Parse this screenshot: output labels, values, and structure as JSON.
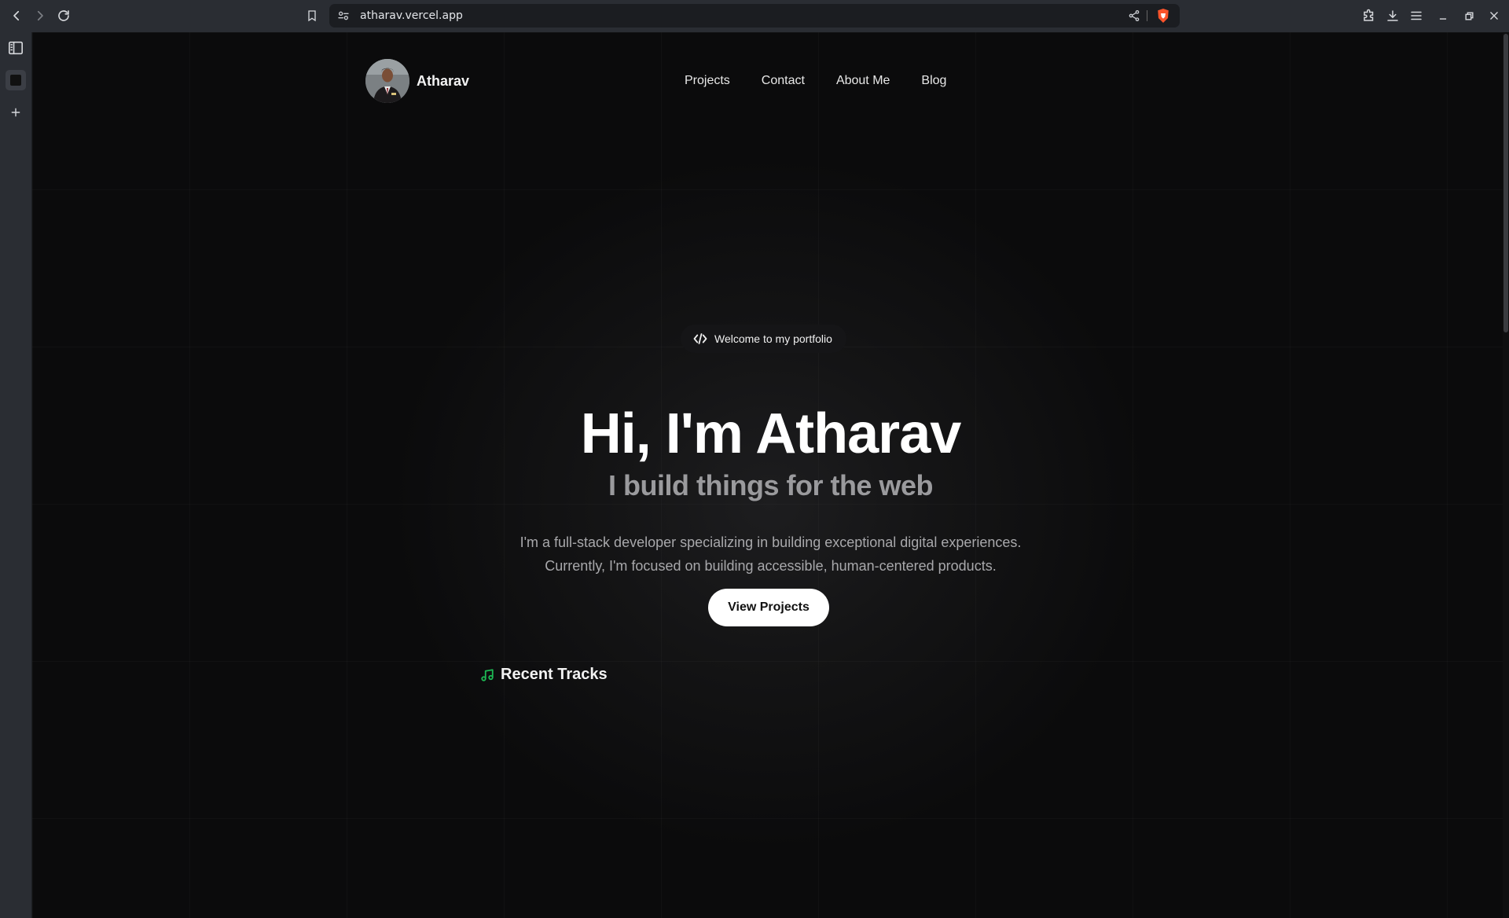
{
  "browser": {
    "url": "atharav.vercel.app"
  },
  "site": {
    "brand": "Atharav",
    "nav": [
      "Projects",
      "Contact",
      "About Me",
      "Blog"
    ]
  },
  "hero": {
    "badge": "Welcome to my portfolio",
    "title": "Hi, I'm Atharav",
    "subtitle": "I build things for the web",
    "description_line1": "I'm a full-stack developer specializing in building exceptional digital experiences.",
    "description_line2": "Currently, I'm focused on building accessible, human-centered products.",
    "cta": "View Projects"
  },
  "tracks": {
    "title": "Recent Tracks",
    "accent": "#1db954"
  }
}
